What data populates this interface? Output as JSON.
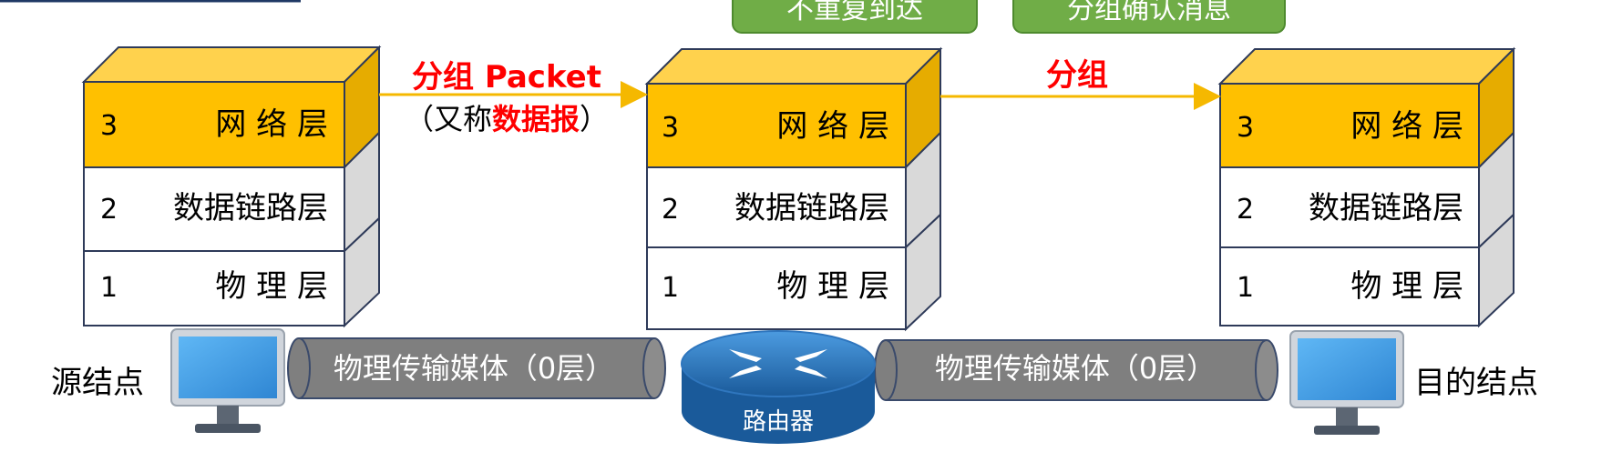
{
  "top_boxes": [
    "不重复到达",
    "分组确认消息"
  ],
  "stacks": [
    {
      "layers": [
        {
          "num": "3",
          "name": "网 络 层"
        },
        {
          "num": "2",
          "name": "数据链路层"
        },
        {
          "num": "1",
          "name": "物 理 层"
        }
      ]
    },
    {
      "layers": [
        {
          "num": "3",
          "name": "网 络 层"
        },
        {
          "num": "2",
          "name": "数据链路层"
        },
        {
          "num": "1",
          "name": "物 理 层"
        }
      ]
    },
    {
      "layers": [
        {
          "num": "3",
          "name": "网 络 层"
        },
        {
          "num": "2",
          "name": "数据链路层"
        },
        {
          "num": "1",
          "name": "物 理 层"
        }
      ]
    }
  ],
  "arrow1": {
    "title": "分组 Packet",
    "sub_prefix": "（又称",
    "sub_emph": "数据报",
    "sub_suffix": "）"
  },
  "arrow2": {
    "title": "分组"
  },
  "media": [
    "物理传输媒体（0层）",
    "物理传输媒体（0层）"
  ],
  "router_label": "路由器",
  "source_label": "源结点",
  "dest_label": "目的结点",
  "colors": {
    "network_layer": "#FFC000",
    "accent_red": "#FF0000",
    "arrow": "#F5B800",
    "box_green": "#70AD47",
    "medium_gray": "#7F7F7F",
    "router_blue": "#1F6FB5"
  },
  "icons": [
    "computer-icon",
    "router-icon"
  ]
}
